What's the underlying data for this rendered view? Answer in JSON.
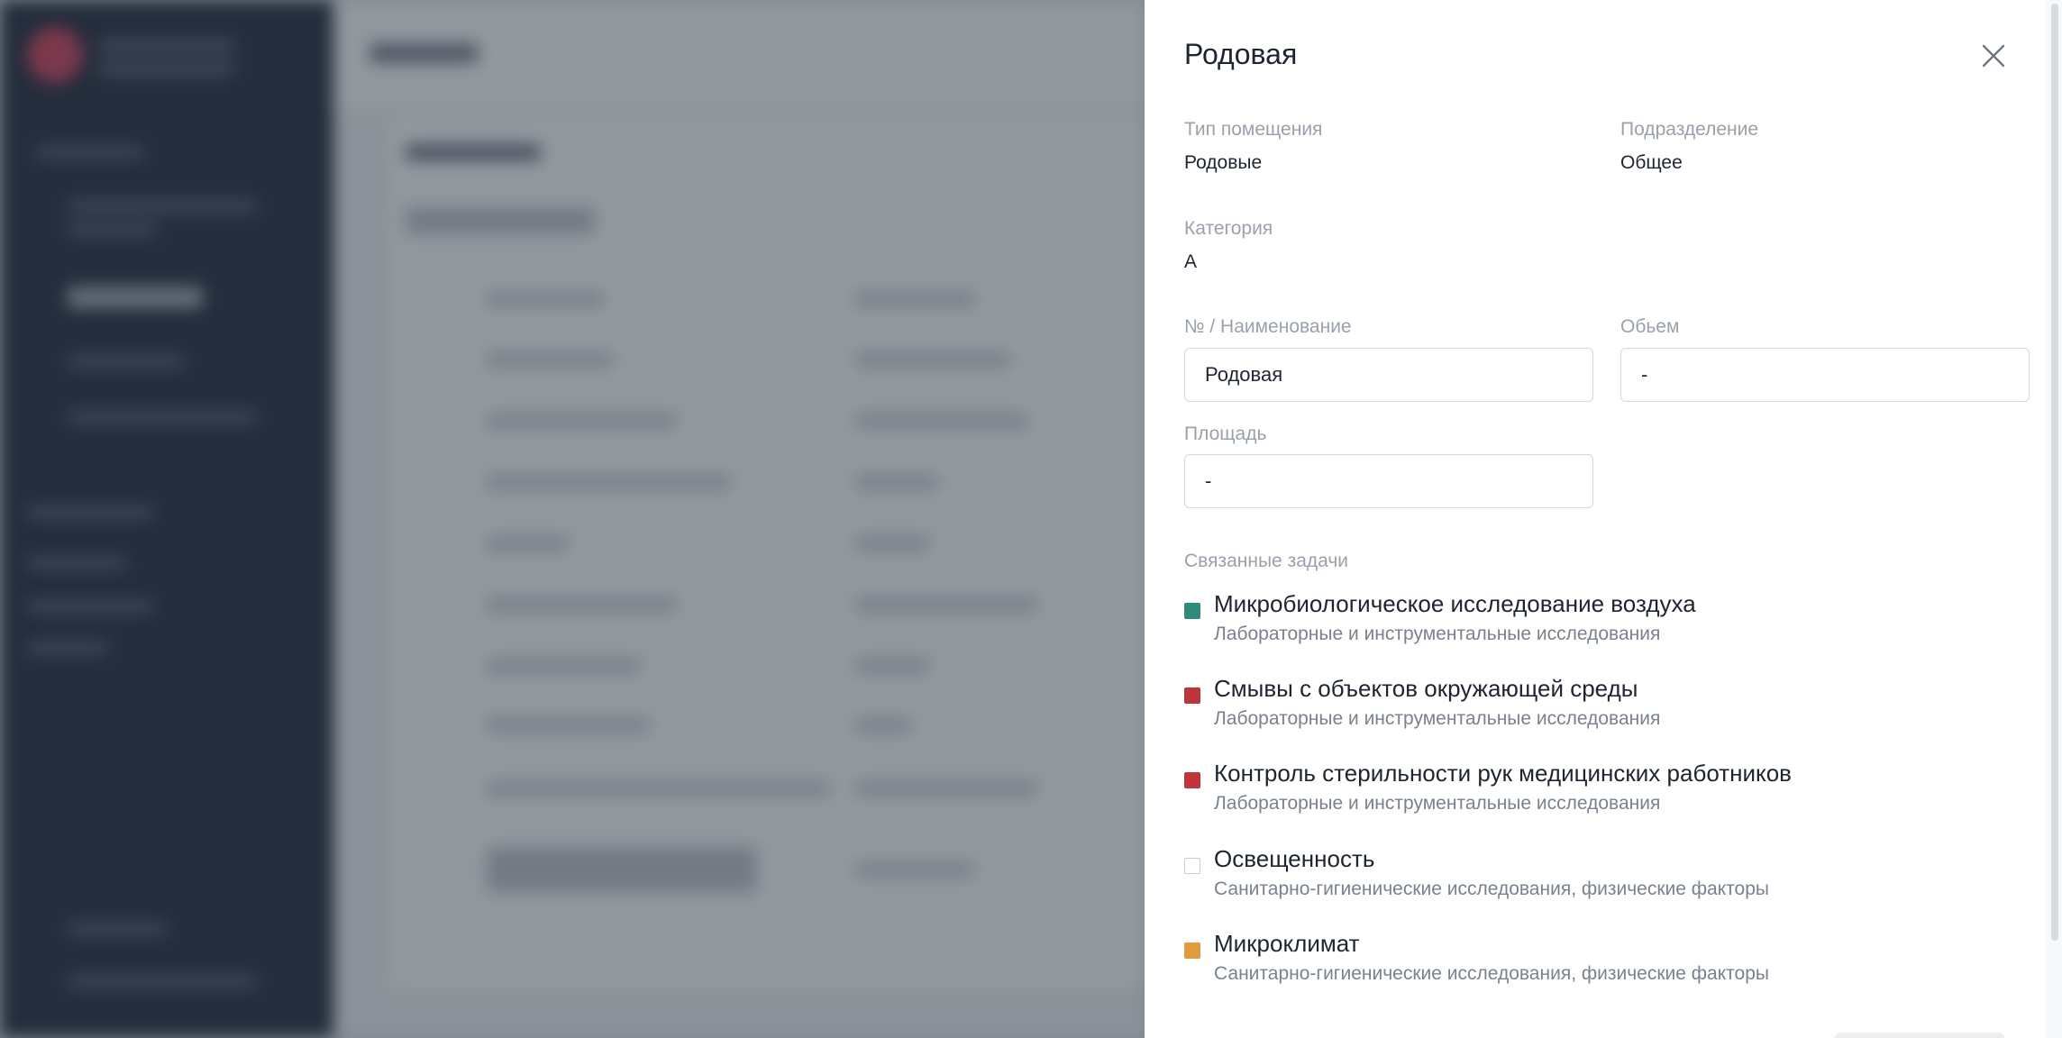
{
  "drawer": {
    "title": "Родовая",
    "room_type": {
      "label": "Тип помещения",
      "value": "Родовые"
    },
    "division": {
      "label": "Подразделение",
      "value": "Общее"
    },
    "category": {
      "label": "Категория",
      "value": "А"
    },
    "name": {
      "label": "№ / Наименование",
      "value": "Родовая"
    },
    "volume": {
      "label": "Обьем",
      "value": "-"
    },
    "area": {
      "label": "Площадь",
      "value": "-"
    },
    "tasks_label": "Связанные задачи",
    "tasks": [
      {
        "title": "Микробиологическое исследование воздуха",
        "subtitle": "Лабораторные и инструментальные исследования",
        "color": "#2e8b7a"
      },
      {
        "title": "Смывы с объектов окружающей среды",
        "subtitle": "Лабораторные и инструментальные исследования",
        "color": "#c0343b"
      },
      {
        "title": "Контроль стерильности рук медицинских работников",
        "subtitle": "Лабораторные и инструментальные исследования",
        "color": "#c0343b"
      },
      {
        "title": "Освещенность",
        "subtitle": "Санитарно-гигиенические исследования, физические факторы",
        "color": "#ffffff"
      },
      {
        "title": "Микроклимат",
        "subtitle": "Санитарно-гигиенические исследования, физические факторы",
        "color": "#e29a3e"
      }
    ]
  }
}
